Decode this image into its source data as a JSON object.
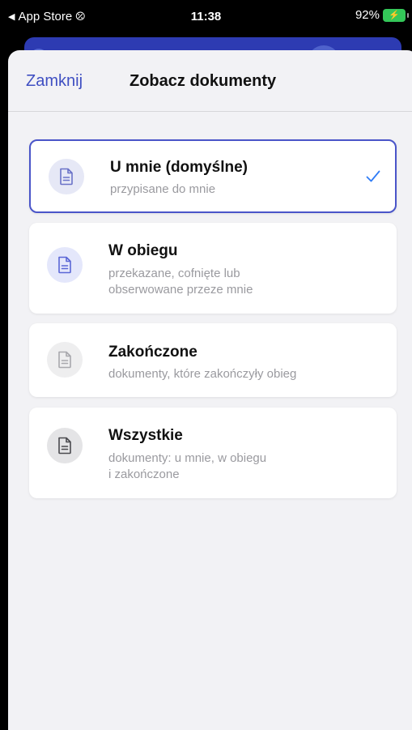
{
  "status_bar": {
    "back_app": "App Store",
    "link_glyph": "⦼",
    "time": "11:38",
    "battery_percent": "92%",
    "battery_glyph": "⚡"
  },
  "header": {
    "close_label": "Zamknij",
    "title": "Zobacz dokumenty"
  },
  "options": [
    {
      "title": "U mnie (domyślne)",
      "subtitle_lines": [
        "przypisane do mnie"
      ],
      "selected": true,
      "icon": "document-icon",
      "icon_bg": "#e6e8f6",
      "icon_color": "#6a72c8"
    },
    {
      "title": "W obiegu",
      "subtitle_lines": [
        "przekazane, cofnięte lub",
        "obserwowane przeze mnie"
      ],
      "selected": false,
      "icon": "document-icon",
      "icon_bg": "#e4e7fb",
      "icon_color": "#5a66d6"
    },
    {
      "title": "Zakończone",
      "subtitle_lines": [
        "dokumenty, które zakończyły obieg"
      ],
      "selected": false,
      "icon": "document-icon",
      "icon_bg": "#eeeeef",
      "icon_color": "#a8a8ad"
    },
    {
      "title": "Wszystkie",
      "subtitle_lines": [
        "dokumenty: u mnie, w obiegu",
        "i zakończone"
      ],
      "selected": false,
      "icon": "document-icon",
      "icon_bg": "#e4e4e6",
      "icon_color": "#4a4a4f"
    }
  ],
  "colors": {
    "accent": "#3f4fc2",
    "check": "#2f7cf6",
    "selected_border": "#4a55c9"
  }
}
